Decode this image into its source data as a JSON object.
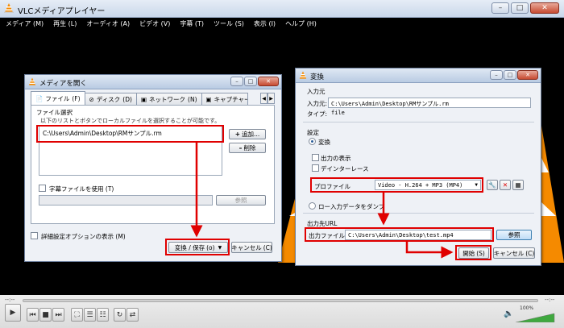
{
  "vlc": {
    "title": "VLCメディアプレイヤー",
    "menu": [
      "メディア (M)",
      "再生 (L)",
      "オーディオ (A)",
      "ビデオ (V)",
      "字幕 (T)",
      "ツール (S)",
      "表示 (I)",
      "ヘルプ (H)"
    ],
    "time_left": "--:--",
    "time_right": "--:--",
    "volume_label": "100%"
  },
  "open_media": {
    "title": "メディアを開く",
    "tabs": [
      {
        "label": "ファイル",
        "shortcut": "(F)",
        "icon": "file-icon"
      },
      {
        "label": "ディスク",
        "shortcut": "(D)",
        "icon": "disc-icon"
      },
      {
        "label": "ネットワーク",
        "shortcut": "(N)",
        "icon": "network-icon"
      },
      {
        "label": "キャプチャー",
        "icon": "capture-icon"
      }
    ],
    "file_section_label": "ファイル選択",
    "file_hint": "以下のリストとボタンでローカルファイルを選択することが可能です。",
    "file_item": "C:\\Users\\Admin\\Desktop\\RMサンプル.rm",
    "add_button": "追加...",
    "remove_button": "削除",
    "subtitle_checkbox": "字幕ファイルを使用",
    "subtitle_shortcut": "(T)",
    "browse_button": "参照",
    "advanced_checkbox": "詳細設定オプションの表示",
    "advanced_shortcut": "(M)",
    "convert_button": "変換 / 保存",
    "convert_shortcut": "(o)",
    "cancel_button": "キャンセル",
    "cancel_shortcut": "(C)"
  },
  "convert": {
    "title": "変換",
    "source_section": "入力元",
    "source_label": "入力元:",
    "source_value": "C:\\Users\\Admin\\Desktop\\RMサンプル.rm",
    "type_label": "タイプ:",
    "type_value": "file",
    "settings_section": "設定",
    "convert_radio": "変換",
    "show_output_checkbox": "出力の表示",
    "deinterlace_checkbox": "デインターレース",
    "profile_label": "プロファイル",
    "profile_value": "Video - H.264 + MP3 (MP4)",
    "dump_radio": "ロー入力データをダンプ",
    "dest_section": "出力先URL",
    "dest_label": "出力ファイル:",
    "dest_value": "C:\\Users\\Admin\\Desktop\\test.mp4",
    "browse_button": "参照",
    "start_button": "開始",
    "start_shortcut": "(S)",
    "cancel_button": "キャンセル",
    "cancel_shortcut": "(C)"
  },
  "colors": {
    "highlight": "#e00000",
    "video_bg": "#000000",
    "dialog_bg": "#eef1f6"
  }
}
